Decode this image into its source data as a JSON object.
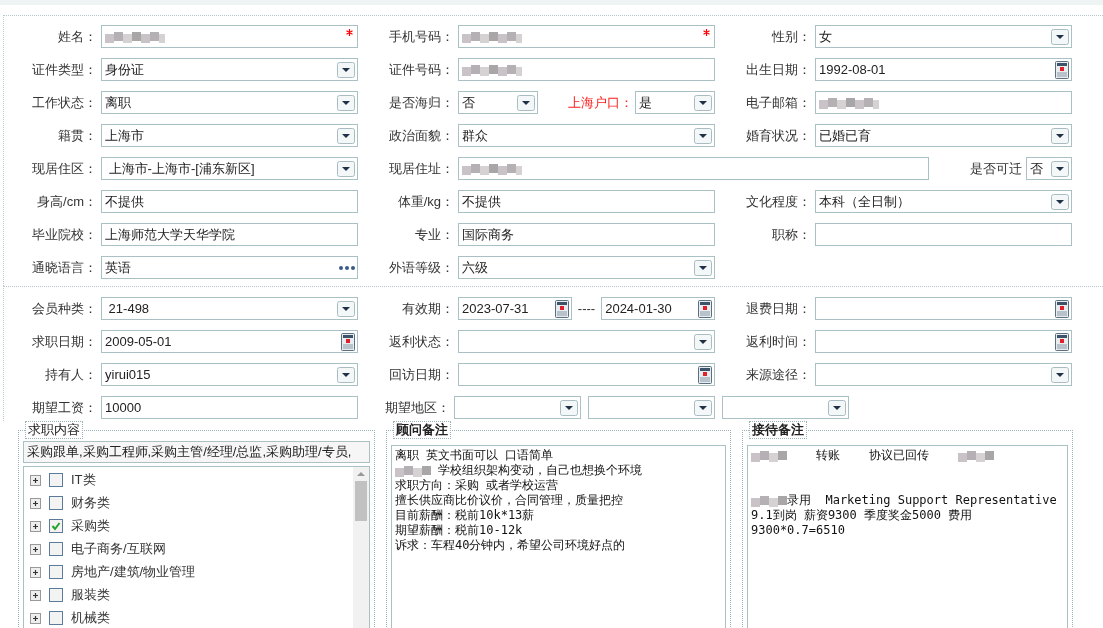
{
  "basic_info": {
    "rows": [
      {
        "kind": "standard",
        "cells": [
          {
            "label": "姓名：",
            "parts": [
              {
                "kind": "text",
                "redacted": true,
                "required": true
              }
            ]
          },
          {
            "label": "手机号码：",
            "parts": [
              {
                "kind": "text",
                "redacted": true,
                "required": true
              }
            ]
          },
          {
            "label": "性别：",
            "parts": [
              {
                "kind": "select",
                "value": "女",
                "required": false
              }
            ]
          }
        ]
      },
      {
        "kind": "standard",
        "cells": [
          {
            "label": "证件类型：",
            "parts": [
              {
                "kind": "select",
                "value": "身份证",
                "required": false
              }
            ]
          },
          {
            "label": "证件号码：",
            "parts": [
              {
                "kind": "text",
                "redacted": true,
                "required": false
              }
            ]
          },
          {
            "label": "出生日期：",
            "parts": [
              {
                "kind": "date",
                "value": "1992-08-01",
                "required": false
              }
            ]
          }
        ]
      },
      {
        "kind": "standard",
        "cells": [
          {
            "label": "工作状态：",
            "parts": [
              {
                "kind": "select",
                "value": "离职",
                "required": false
              }
            ]
          },
          {
            "label": "是否海归：",
            "parts": [
              {
                "kind": "select",
                "value": "否",
                "required": false
              },
              {
                "kind": "label",
                "text": "上海户口：",
                "alert": true
              },
              {
                "kind": "select",
                "value": "是",
                "required": false
              }
            ]
          },
          {
            "label": "电子邮箱：",
            "parts": [
              {
                "kind": "text",
                "redacted": true,
                "required": false
              }
            ]
          }
        ]
      },
      {
        "kind": "standard",
        "cells": [
          {
            "label": "籍贯：",
            "parts": [
              {
                "kind": "select",
                "value": "上海市",
                "required": false
              }
            ]
          },
          {
            "label": "政治面貌：",
            "parts": [
              {
                "kind": "select",
                "value": "群众",
                "required": false
              }
            ]
          },
          {
            "label": "婚育状况：",
            "parts": [
              {
                "kind": "select",
                "value": "已婚已育",
                "required": false
              }
            ]
          }
        ]
      },
      {
        "kind": "address",
        "cells": [
          {
            "label": "现居住区：",
            "parts": [
              {
                "kind": "select",
                "value": " 上海市-上海市-[浦东新区]",
                "required": false
              }
            ]
          },
          {
            "label": "现居住址：",
            "parts": [
              {
                "kind": "text",
                "redacted": true,
                "required": false
              }
            ]
          },
          {
            "label": "是否可迁",
            "parts": [
              {
                "kind": "select",
                "value": "否",
                "required": false
              }
            ]
          }
        ]
      },
      {
        "kind": "standard",
        "cells": [
          {
            "label": "身高/cm：",
            "parts": [
              {
                "kind": "text",
                "value": "不提供",
                "required": false
              }
            ]
          },
          {
            "label": "体重/kg：",
            "parts": [
              {
                "kind": "text",
                "value": "不提供",
                "required": false
              }
            ]
          },
          {
            "label": "文化程度：",
            "parts": [
              {
                "kind": "select",
                "value": "本科（全日制）",
                "required": false
              }
            ]
          }
        ]
      },
      {
        "kind": "standard",
        "cells": [
          {
            "label": "毕业院校：",
            "parts": [
              {
                "kind": "text",
                "value": "上海师范大学天华学院",
                "required": false
              }
            ]
          },
          {
            "label": "专业：",
            "parts": [
              {
                "kind": "text",
                "value": "国际商务",
                "required": false
              }
            ]
          },
          {
            "label": "职称：",
            "parts": [
              {
                "kind": "text",
                "required": false
              }
            ]
          }
        ]
      },
      {
        "kind": "standard",
        "cells": [
          {
            "label": "通晓语言：",
            "parts": [
              {
                "kind": "lookup",
                "value": "英语",
                "required": false
              }
            ]
          },
          {
            "label": "外语等级：",
            "parts": [
              {
                "kind": "select",
                "value": "六级",
                "required": false
              }
            ]
          }
        ]
      }
    ]
  },
  "membership": {
    "rows": [
      {
        "kind": "standard",
        "cells": [
          {
            "label": "会员种类：",
            "parts": [
              {
                "kind": "select",
                "value": " 21-498",
                "required": false
              }
            ]
          },
          {
            "label": "有效期：",
            "parts": [
              {
                "kind": "date",
                "value": "2023-07-31",
                "required": false
              },
              {
                "kind": "separator",
                "text": "----"
              },
              {
                "kind": "date",
                "value": "2024-01-30",
                "required": false
              }
            ]
          },
          {
            "label": "退费日期：",
            "parts": [
              {
                "kind": "date",
                "required": false
              }
            ]
          }
        ]
      },
      {
        "kind": "standard",
        "cells": [
          {
            "label": "求职日期：",
            "parts": [
              {
                "kind": "date",
                "value": "2009-05-01",
                "required": false
              }
            ]
          },
          {
            "label": "返利状态：",
            "parts": [
              {
                "kind": "select",
                "required": false
              }
            ]
          },
          {
            "label": "返利时间：",
            "parts": [
              {
                "kind": "date",
                "required": false
              }
            ]
          }
        ]
      },
      {
        "kind": "standard",
        "cells": [
          {
            "label": "持有人：",
            "parts": [
              {
                "kind": "select",
                "value": "yirui015",
                "required": false
              }
            ]
          },
          {
            "label": "回访日期：",
            "parts": [
              {
                "kind": "date",
                "required": false
              }
            ]
          },
          {
            "label": "来源途径：",
            "parts": [
              {
                "kind": "select",
                "required": false
              }
            ]
          }
        ]
      },
      {
        "kind": "region",
        "cells": [
          {
            "label": "期望工资：",
            "parts": [
              {
                "kind": "text",
                "value": "10000",
                "required": false
              }
            ]
          },
          {
            "label": "期望地区：",
            "parts": [
              {
                "kind": "select",
                "required": false
              },
              {
                "kind": "select",
                "required": false
              },
              {
                "kind": "select",
                "required": false
              }
            ]
          }
        ]
      }
    ]
  },
  "job_intent": {
    "title": "求职内容",
    "bold_title": false,
    "selection": "采购跟单,采购工程师,采购主管/经理/总监,采购助理/专员,",
    "categories": [
      {
        "label": "IT类",
        "checked": false,
        "expanded": false
      },
      {
        "label": "财务类",
        "checked": false,
        "expanded": false
      },
      {
        "label": "采购类",
        "checked": true,
        "expanded": false
      },
      {
        "label": "电子商务/互联网",
        "checked": false,
        "expanded": false
      },
      {
        "label": "房地产/建筑/物业管理",
        "checked": false,
        "expanded": false
      },
      {
        "label": "服装类",
        "checked": false,
        "expanded": false
      },
      {
        "label": "机械类",
        "checked": false,
        "expanded": false
      }
    ]
  },
  "notes": [
    {
      "title": "顾问备注",
      "bold_title": true,
      "lines": [
        {
          "kind": "text",
          "segments": [
            {
              "kind": "text",
              "text": "离职 英文书面可以 口语简单"
            }
          ]
        },
        {
          "kind": "text",
          "segments": [
            {
              "kind": "redacted"
            },
            {
              "kind": "text",
              "text": " 学校组织架构变动，自己也想换个环境"
            }
          ]
        },
        {
          "kind": "text",
          "segments": [
            {
              "kind": "text",
              "text": "求职方向：采购 或者学校运营"
            }
          ]
        },
        {
          "kind": "text",
          "segments": [
            {
              "kind": "text",
              "text": "擅长供应商比价议价，合同管理，质量把控"
            }
          ]
        },
        {
          "kind": "text",
          "segments": [
            {
              "kind": "text",
              "text": "目前薪酬：税前10k*13薪"
            }
          ]
        },
        {
          "kind": "text",
          "segments": [
            {
              "kind": "text",
              "text": "期望薪酬：税前10-12k"
            }
          ]
        },
        {
          "kind": "text",
          "segments": [
            {
              "kind": "text",
              "text": "诉求：车程40分钟内，希望公司环境好点的"
            }
          ]
        }
      ]
    },
    {
      "title": "接待备注",
      "bold_title": true,
      "lines": [
        {
          "kind": "text",
          "segments": [
            {
              "kind": "redacted"
            },
            {
              "kind": "text",
              "text": "    转账    协议已回传    "
            },
            {
              "kind": "redacted"
            }
          ]
        },
        {
          "kind": "blank"
        },
        {
          "kind": "blank"
        },
        {
          "kind": "text",
          "segments": [
            {
              "kind": "redacted"
            },
            {
              "kind": "text",
              "text": "录用  Marketing Support Representative 9.1到岗 薪资9300 季度奖金5000 费用9300*0.7=6510"
            }
          ]
        }
      ]
    }
  ]
}
